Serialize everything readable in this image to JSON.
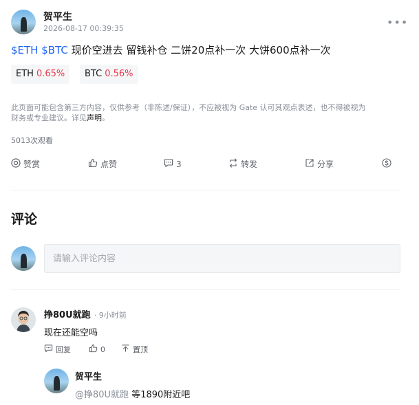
{
  "post": {
    "author": "贺平生",
    "time": "2026-08-17 00:39:35",
    "more": "•••",
    "tickers": [
      "$ETH",
      "$BTC"
    ],
    "text": "现价空进去 留钱补仓 二饼20点补一次 大饼600点补一次",
    "chips": [
      {
        "name": "ETH",
        "change": "0.65%"
      },
      {
        "name": "BTC",
        "change": "0.56%"
      }
    ],
    "disclaimer_line1": "此页面可能包含第三方内容，仅供参考（非陈述/保证），不应被视为 Gate 认可其观点表述，也不得被视为",
    "disclaimer_line2": "财务或专业建议。详见",
    "disclaimer_link": "声明",
    "disclaimer_end": "。",
    "views": "5013次观看",
    "actions": {
      "reward": "赞赏",
      "like": "点赞",
      "comments": "3",
      "repost": "转发",
      "share": "分享"
    }
  },
  "comments_section": {
    "title": "评论",
    "input_placeholder": "请输入评论内容"
  },
  "comments": [
    {
      "author": "挣80U就跑",
      "time": "· 9小时前",
      "text": "现在还能空吗",
      "reply_label": "回复",
      "likes": "0",
      "pin_label": "置顶",
      "replies": [
        {
          "author": "贺平生",
          "mention": "@挣80U就跑",
          "text": "等1890附近吧"
        }
      ]
    }
  ]
}
